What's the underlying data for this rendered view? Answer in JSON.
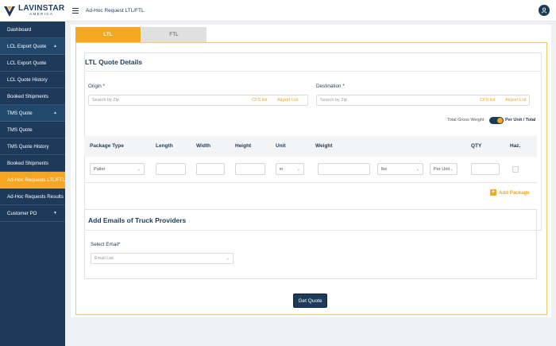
{
  "brand": {
    "name": "LAVINSTAR",
    "sub": "AMERICA"
  },
  "header": {
    "title": "Ad-Hoc Request LTL/FTL"
  },
  "sidebar": {
    "items": [
      {
        "label": "Dashboard"
      },
      {
        "label": "LCL Export Quote"
      },
      {
        "label": "LCL Export Quote"
      },
      {
        "label": "LCL Quote History"
      },
      {
        "label": "Booked Shipments"
      },
      {
        "label": "TMS Quote"
      },
      {
        "label": "TMS Quote"
      },
      {
        "label": "TMS Quote History"
      },
      {
        "label": "Booked Shipments"
      },
      {
        "label": "Ad-Hoc Requests LTL/FTL"
      },
      {
        "label": "Ad-Hoc Requests Results"
      },
      {
        "label": "Customer PO"
      }
    ]
  },
  "tabs": {
    "ltl": "LTL",
    "ftl": "FTL"
  },
  "form": {
    "title": "LTL Quote Details",
    "origin": {
      "label": "Origin *",
      "placeholder": "Search by Zip",
      "cfs": "CFS list",
      "airport": "Airport List"
    },
    "destination": {
      "label": "Destination *",
      "placeholder": "Search by Zip",
      "cfs": "CFS list",
      "airport": "Airport List"
    },
    "total_gross_weight_label": "Total Gross Weight",
    "toggle_label": "Per Unit / Total"
  },
  "table": {
    "headers": {
      "package_type": "Package Type",
      "length": "Length",
      "width": "Width",
      "height": "Height",
      "unit": "Unit",
      "weight": "Weight",
      "qty": "QTY",
      "haz": "Haz."
    },
    "row": {
      "package_type": "Pallet",
      "unit": "in",
      "weight_unit": "lbs",
      "per_unit": "Per Unit"
    }
  },
  "add_package": {
    "plus": "+",
    "label": "Add Package"
  },
  "emails": {
    "title": "Add Emails of Truck Providers",
    "select_label": "Select Email*",
    "placeholder": "Email List"
  },
  "actions": {
    "get_quote": "Get Quote"
  },
  "colors": {
    "navy": "#1d3a5a",
    "accent": "#f5a623"
  }
}
